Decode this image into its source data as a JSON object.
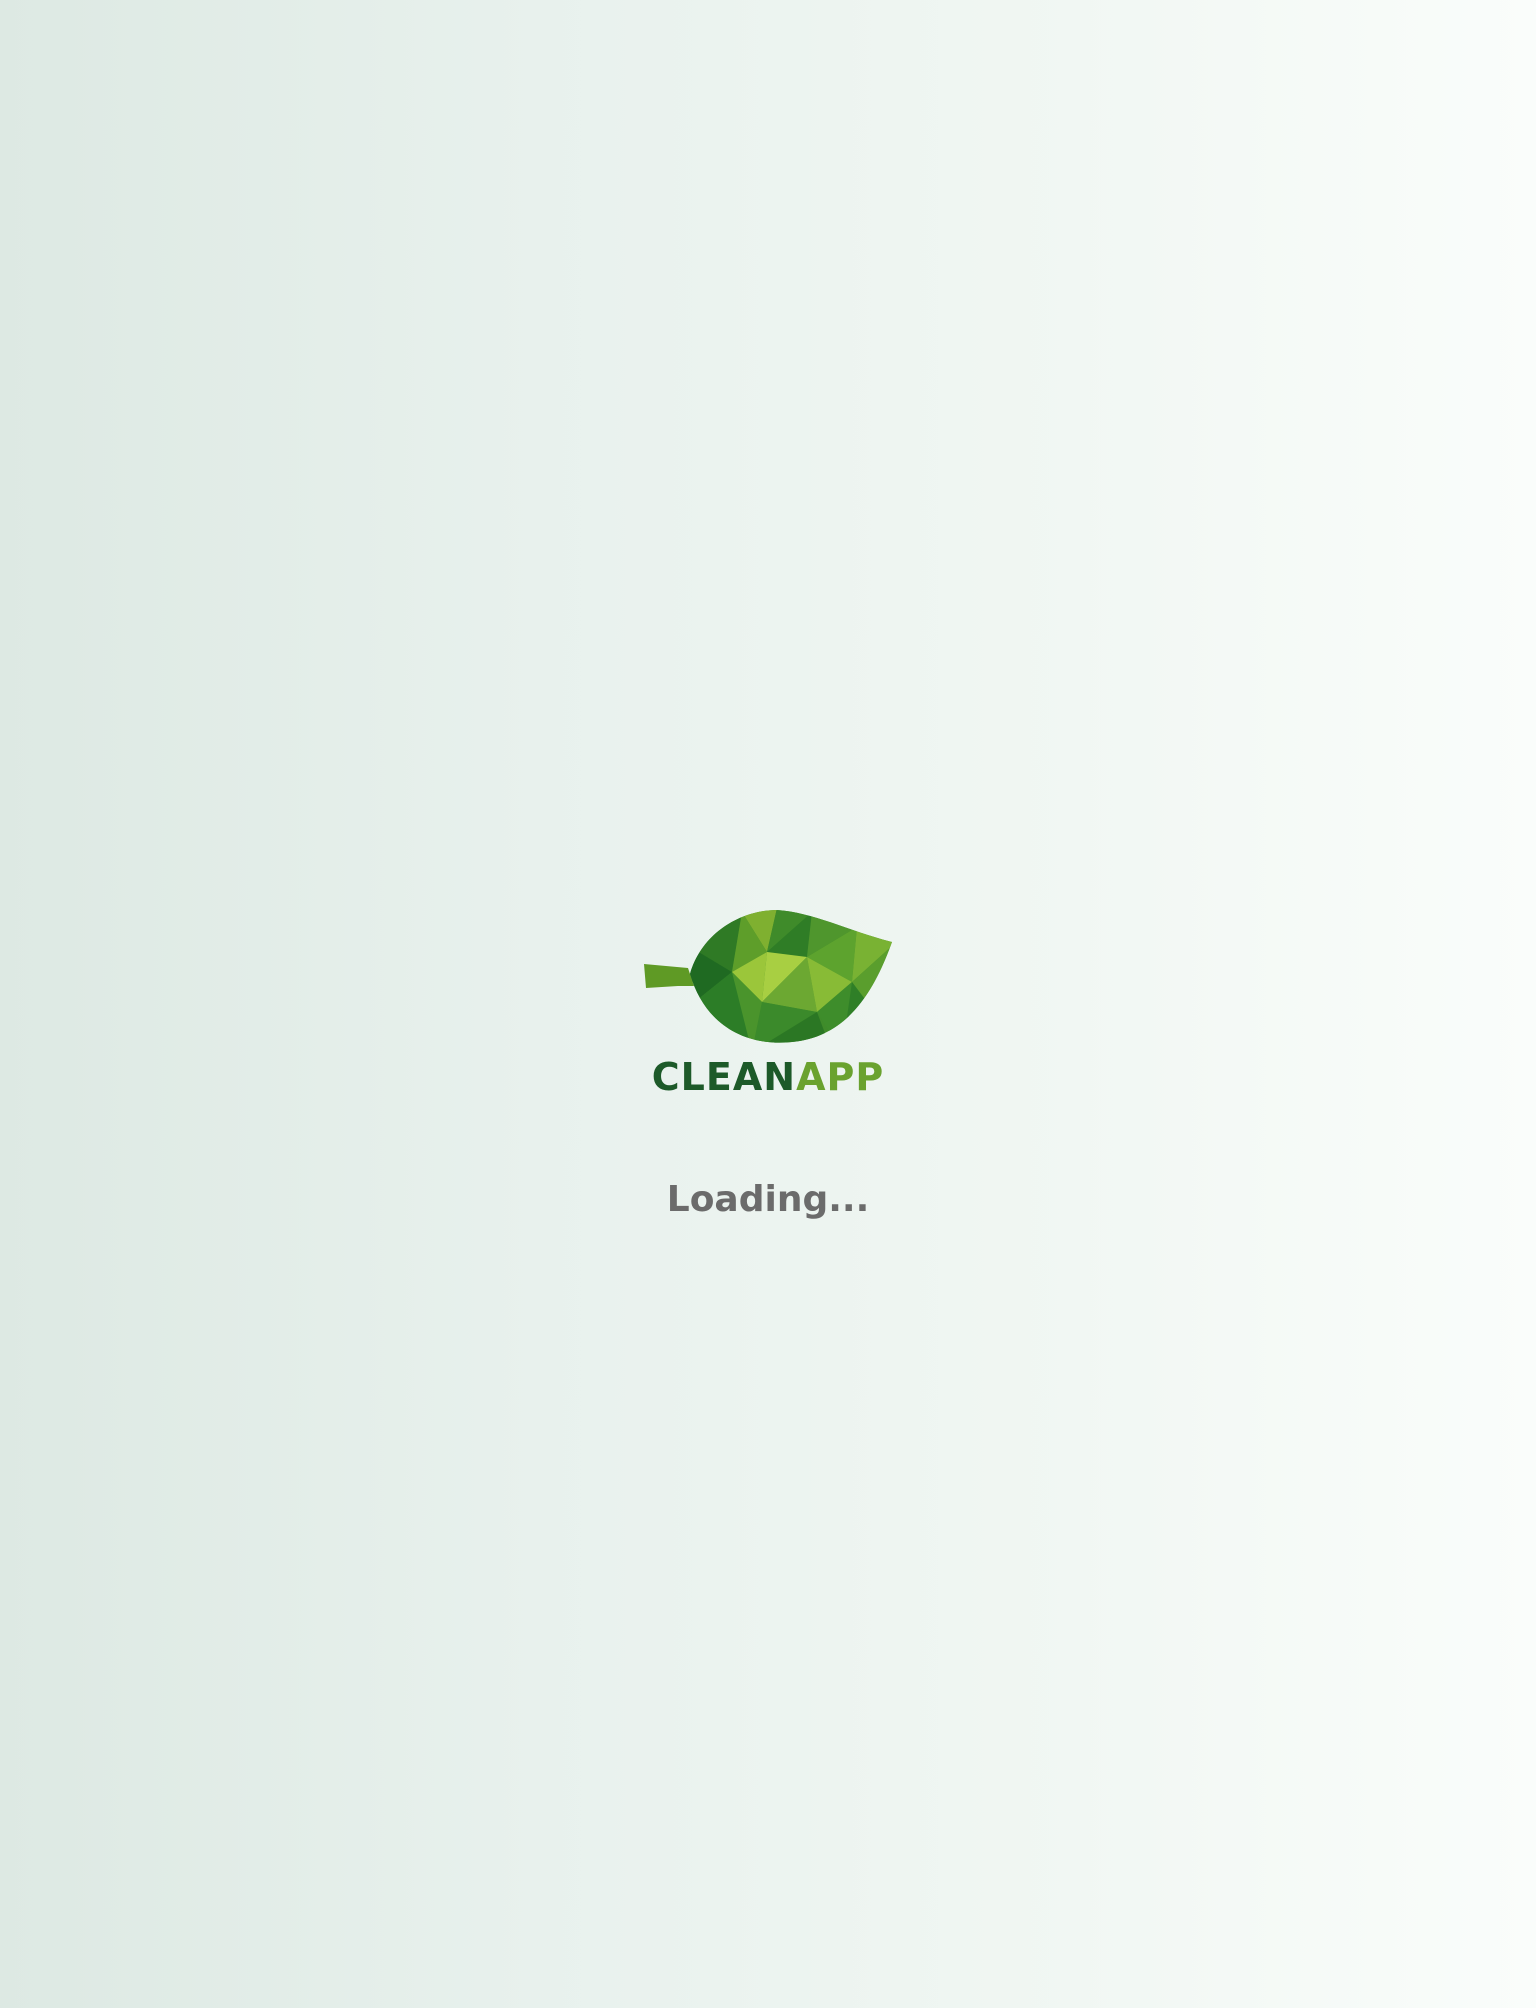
{
  "splash": {
    "logo": {
      "icon": "leaf-icon",
      "wordmark_part_a": "CLEAN",
      "wordmark_part_b": "APP"
    },
    "status_text": "Loading...",
    "colors": {
      "brand_dark_green": "#1d5a29",
      "brand_light_green": "#6aa22f",
      "status_gray": "#6b6b6b"
    }
  }
}
